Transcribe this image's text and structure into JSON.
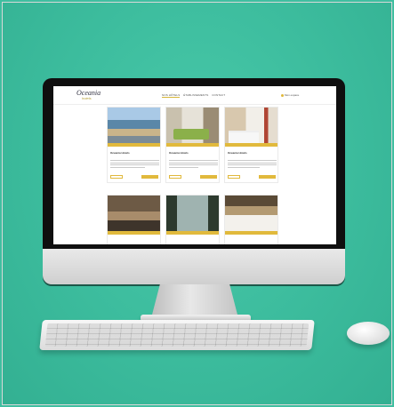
{
  "site": {
    "logo_main": "Oceania",
    "logo_sub": "hotels",
    "nav": [
      "NOS HÔTELS",
      "ÉTABLISSEMENTS",
      "CONTACT"
    ],
    "account": "Mon espace"
  },
  "cards": [
    {
      "title": "Oceania Hotels",
      "photo": "harbor-photo"
    },
    {
      "title": "Oceania Hotels",
      "photo": "room-photo"
    },
    {
      "title": "Oceania Hotels",
      "photo": "bedroom-photo"
    },
    {
      "title": "",
      "photo": "lounge-photo"
    },
    {
      "title": "",
      "photo": "restaurant-photo"
    },
    {
      "title": "",
      "photo": "bed-photo"
    }
  ],
  "colors": {
    "wall": "#3fbfa0",
    "accent": "#e1b93c"
  }
}
